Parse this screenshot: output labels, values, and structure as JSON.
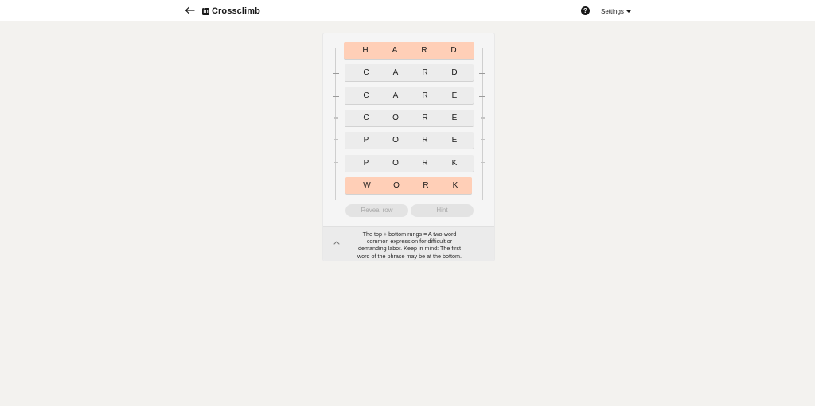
{
  "header": {
    "title": "Crossclimb",
    "logo_text": "in",
    "help_glyph": "?",
    "settings_label": "Settings"
  },
  "rungs": [
    {
      "letters": [
        "H",
        "A",
        "R",
        "D"
      ],
      "kind": "end",
      "underlined": true
    },
    {
      "letters": [
        "C",
        "A",
        "R",
        "D"
      ],
      "kind": "mid",
      "underlined": false
    },
    {
      "letters": [
        "C",
        "A",
        "R",
        "E"
      ],
      "kind": "mid",
      "underlined": false
    },
    {
      "letters": [
        "C",
        "O",
        "R",
        "E"
      ],
      "kind": "mid",
      "underlined": false
    },
    {
      "letters": [
        "P",
        "O",
        "R",
        "E"
      ],
      "kind": "mid",
      "underlined": false
    },
    {
      "letters": [
        "P",
        "O",
        "R",
        "K"
      ],
      "kind": "mid",
      "underlined": false
    },
    {
      "letters": [
        "W",
        "O",
        "R",
        "K"
      ],
      "kind": "end",
      "underlined": true
    }
  ],
  "actions": {
    "reveal_label": "Reveal row",
    "hint_label": "Hint"
  },
  "clue": {
    "lines": [
      "The top + bottom rungs = A two-word",
      "common expression for difficult or",
      "demanding labor. Keep in mind: The first",
      "word of the phrase may be at the bottom."
    ]
  },
  "colors": {
    "end_rung": "#ffcfb7",
    "mid_rung": "#ececec",
    "background": "#f3f2ef"
  },
  "icons": {
    "back": "arrow-left-icon",
    "help": "question-circle-icon",
    "settings_caret": "caret-down-icon",
    "drag_handle": "drag-handle-icon",
    "clue_toggle": "chevron-up-icon"
  }
}
